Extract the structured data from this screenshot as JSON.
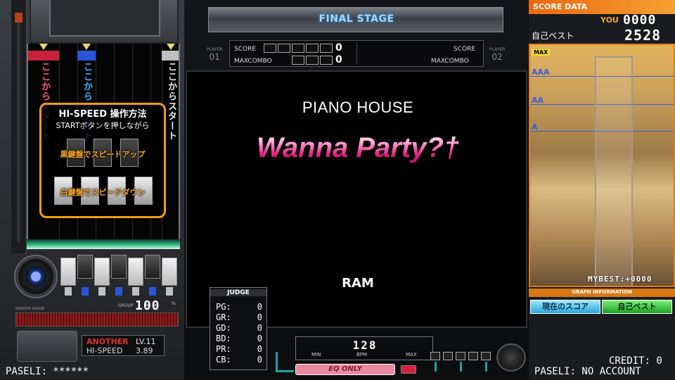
{
  "lanes": {
    "start_text_red": "ここからスタート",
    "start_text_blue": "ここからスタート",
    "start_text_white": "ここからスタート"
  },
  "hispeed_help": {
    "title": "HI-SPEED 操作方法",
    "subtitle": "STARTボタンを押しながら",
    "speed_up": "黒鍵盤でスピードアップ",
    "speed_down": "白鍵盤でスピードダウン"
  },
  "gauge": {
    "label": "GROOVE GAUGE",
    "tag": "GROUP",
    "percent": "100",
    "unit": "%"
  },
  "difficulty": {
    "name": "ANOTHER",
    "level": "LV.11",
    "hispeed_label": "HI-SPEED",
    "hispeed_value": "3.89"
  },
  "stage": {
    "banner": "FINAL STAGE"
  },
  "scoreboard": {
    "player1": "PLAYER 01",
    "player1_top": "PLAYER",
    "player1_num": "01",
    "player2_top": "PLAYER",
    "player2_num": "02",
    "score_label": "SCORE",
    "maxcombo_label": "MAXCOMBO",
    "p1_score": "0",
    "p1_maxcombo": "0",
    "p2_score_label": "SCORE",
    "p2_maxcombo_label": "MAXCOMBO"
  },
  "song": {
    "genre": "PIANO HOUSE",
    "title": "Wanna Party?†",
    "artist": "RAM"
  },
  "judge": {
    "title": "JUDGE",
    "rows": [
      {
        "label": "PG:",
        "value": "0"
      },
      {
        "label": "GR:",
        "value": "0"
      },
      {
        "label": "GD:",
        "value": "0"
      },
      {
        "label": "BD:",
        "value": "0"
      },
      {
        "label": "PR:",
        "value": "0"
      },
      {
        "label": "CB:",
        "value": "0"
      }
    ]
  },
  "bpm": {
    "value": "128",
    "min_label": "MIN",
    "bpm_label": "BPM",
    "max_label": "MAX"
  },
  "eq": {
    "label": "EQ ONLY"
  },
  "score_data": {
    "title": "SCORE DATA",
    "you_label": "YOU",
    "you_score": "0000",
    "best_label": "自己ベスト",
    "best_score": "2528",
    "max_tag": "MAX",
    "grades": [
      "AAA",
      "AA",
      "A"
    ],
    "mybest": "MYBEST:+0000",
    "graph_info": "GRAPH INFORMATION",
    "btn_current": "現在のスコア",
    "btn_best": "自己ベスト"
  },
  "footer": {
    "paseli_left": "PASELI: ******",
    "credit": "CREDIT: 0",
    "paseli_right": "PASELI: NO ACCOUNT"
  },
  "colors": {
    "accent_orange": "#f29a18",
    "title_pink": "#e0207e",
    "gauge_red": "#8c1a1a",
    "grade_blue": "#3c5bd8"
  }
}
